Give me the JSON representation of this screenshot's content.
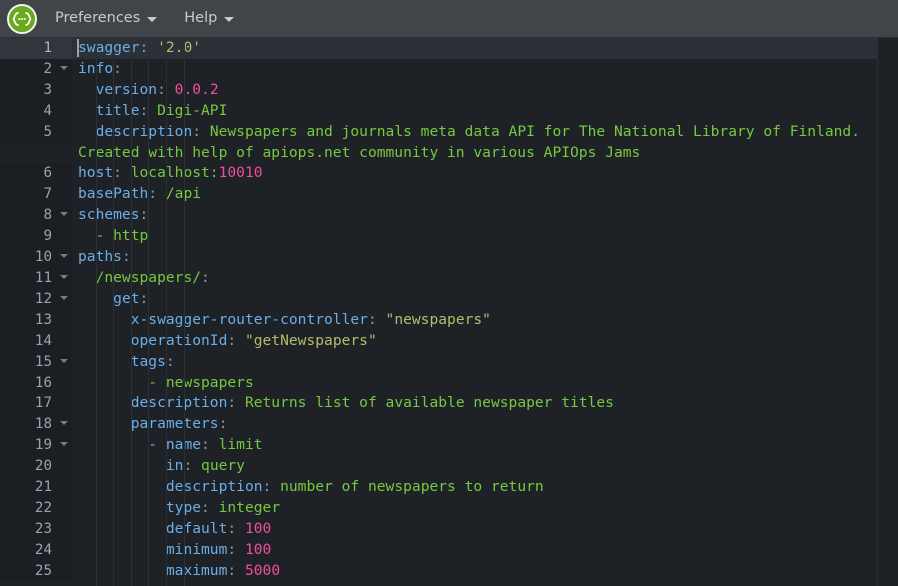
{
  "header": {
    "logo_icon": "swagger-braces-logo-icon",
    "logo_glyph": "{···}",
    "menus": [
      {
        "label": "Preferences",
        "icon": "chevron-down-icon"
      },
      {
        "label": "Help",
        "icon": "chevron-down-icon"
      }
    ]
  },
  "editor": {
    "language": "yaml",
    "active_line": 1,
    "colors": {
      "background": "#1e2227",
      "gutter_background": "#1b1f23",
      "active_line_background": "#2c3137",
      "key": "#6aaee8",
      "string": "#b5bd68",
      "number": "#ef4f9c",
      "value": "#76c93e",
      "header_background": "#414549",
      "logo_green": "#6aa81e"
    },
    "lines": [
      {
        "num": "1",
        "fold": false,
        "indent": 0,
        "tokens": [
          {
            "t": "swagger",
            "c": "k"
          },
          {
            "t": ": ",
            "c": "p"
          },
          {
            "t": "'2.0'",
            "c": "s"
          }
        ]
      },
      {
        "num": "2",
        "fold": true,
        "indent": 0,
        "tokens": [
          {
            "t": "info",
            "c": "k"
          },
          {
            "t": ":",
            "c": "p"
          }
        ]
      },
      {
        "num": "3",
        "fold": false,
        "indent": 1,
        "tokens": [
          {
            "t": "  version",
            "c": "k"
          },
          {
            "t": ": ",
            "c": "p"
          },
          {
            "t": "0.0.2",
            "c": "n"
          }
        ]
      },
      {
        "num": "4",
        "fold": false,
        "indent": 1,
        "tokens": [
          {
            "t": "  title",
            "c": "k"
          },
          {
            "t": ": ",
            "c": "p"
          },
          {
            "t": "Digi-API",
            "c": "v"
          }
        ]
      },
      {
        "num": "5",
        "fold": false,
        "indent": 1,
        "tokens": [
          {
            "t": "  description",
            "c": "k"
          },
          {
            "t": ": ",
            "c": "p"
          },
          {
            "t": "Newspapers and journals meta data API for The National Library of Finland. Created with help of apiops.net community in various APIOps Jams",
            "c": "v"
          }
        ]
      },
      {
        "num": "6",
        "fold": false,
        "indent": 0,
        "tokens": [
          {
            "t": "host",
            "c": "k"
          },
          {
            "t": ": ",
            "c": "p"
          },
          {
            "t": "localhost:",
            "c": "v"
          },
          {
            "t": "10010",
            "c": "n"
          }
        ]
      },
      {
        "num": "7",
        "fold": false,
        "indent": 0,
        "tokens": [
          {
            "t": "basePath",
            "c": "k"
          },
          {
            "t": ": ",
            "c": "p"
          },
          {
            "t": "/api",
            "c": "v"
          }
        ]
      },
      {
        "num": "8",
        "fold": true,
        "indent": 0,
        "tokens": [
          {
            "t": "schemes",
            "c": "k"
          },
          {
            "t": ":",
            "c": "p"
          }
        ]
      },
      {
        "num": "9",
        "fold": false,
        "indent": 1,
        "tokens": [
          {
            "t": "  - http",
            "c": "v"
          }
        ]
      },
      {
        "num": "10",
        "fold": true,
        "indent": 0,
        "tokens": [
          {
            "t": "paths",
            "c": "k"
          },
          {
            "t": ":",
            "c": "p"
          }
        ]
      },
      {
        "num": "11",
        "fold": true,
        "indent": 1,
        "tokens": [
          {
            "t": "  /newspapers/",
            "c": "v"
          },
          {
            "t": ":",
            "c": "p"
          }
        ]
      },
      {
        "num": "12",
        "fold": true,
        "indent": 2,
        "tokens": [
          {
            "t": "    get",
            "c": "k"
          },
          {
            "t": ":",
            "c": "p"
          }
        ]
      },
      {
        "num": "13",
        "fold": false,
        "indent": 3,
        "tokens": [
          {
            "t": "      x-swagger-router-controller",
            "c": "k"
          },
          {
            "t": ": ",
            "c": "p"
          },
          {
            "t": "\"newspapers\"",
            "c": "s"
          }
        ]
      },
      {
        "num": "14",
        "fold": false,
        "indent": 3,
        "tokens": [
          {
            "t": "      operationId",
            "c": "k"
          },
          {
            "t": ": ",
            "c": "p"
          },
          {
            "t": "\"getNewspapers\"",
            "c": "s"
          }
        ]
      },
      {
        "num": "15",
        "fold": true,
        "indent": 3,
        "tokens": [
          {
            "t": "      tags",
            "c": "k"
          },
          {
            "t": ":",
            "c": "p"
          }
        ]
      },
      {
        "num": "16",
        "fold": false,
        "indent": 4,
        "tokens": [
          {
            "t": "        - newspapers",
            "c": "v"
          }
        ]
      },
      {
        "num": "17",
        "fold": false,
        "indent": 3,
        "tokens": [
          {
            "t": "      description",
            "c": "k"
          },
          {
            "t": ": ",
            "c": "p"
          },
          {
            "t": "Returns list of available newspaper titles",
            "c": "v"
          }
        ]
      },
      {
        "num": "18",
        "fold": true,
        "indent": 3,
        "tokens": [
          {
            "t": "      parameters",
            "c": "k"
          },
          {
            "t": ":",
            "c": "p"
          }
        ]
      },
      {
        "num": "19",
        "fold": true,
        "indent": 4,
        "tokens": [
          {
            "t": "        - name",
            "c": "k"
          },
          {
            "t": ": ",
            "c": "p"
          },
          {
            "t": "limit",
            "c": "v"
          }
        ]
      },
      {
        "num": "20",
        "fold": false,
        "indent": 5,
        "tokens": [
          {
            "t": "          in",
            "c": "k"
          },
          {
            "t": ": ",
            "c": "p"
          },
          {
            "t": "query",
            "c": "v"
          }
        ]
      },
      {
        "num": "21",
        "fold": false,
        "indent": 5,
        "tokens": [
          {
            "t": "          description",
            "c": "k"
          },
          {
            "t": ": ",
            "c": "p"
          },
          {
            "t": "number of newspapers to return",
            "c": "v"
          }
        ]
      },
      {
        "num": "22",
        "fold": false,
        "indent": 5,
        "tokens": [
          {
            "t": "          type",
            "c": "k"
          },
          {
            "t": ": ",
            "c": "p"
          },
          {
            "t": "integer",
            "c": "v"
          }
        ]
      },
      {
        "num": "23",
        "fold": false,
        "indent": 5,
        "tokens": [
          {
            "t": "          default",
            "c": "k"
          },
          {
            "t": ": ",
            "c": "p"
          },
          {
            "t": "100",
            "c": "n"
          }
        ]
      },
      {
        "num": "24",
        "fold": false,
        "indent": 5,
        "tokens": [
          {
            "t": "          minimum",
            "c": "k"
          },
          {
            "t": ": ",
            "c": "p"
          },
          {
            "t": "100",
            "c": "n"
          }
        ]
      },
      {
        "num": "25",
        "fold": false,
        "indent": 5,
        "tokens": [
          {
            "t": "          maximum",
            "c": "k"
          },
          {
            "t": ": ",
            "c": "p"
          },
          {
            "t": "5000",
            "c": "n"
          }
        ]
      }
    ]
  }
}
